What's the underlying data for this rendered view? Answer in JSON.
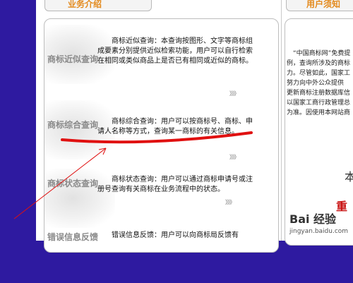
{
  "tabs": {
    "left_label": "业务介绍",
    "right_label": "用户须知"
  },
  "services": [
    {
      "name": "商标近似查询",
      "desc": "　　商标近似查询：本查询按图形、文字等商标组成要素分别提供近似检索功能，用户可以自行检索在相同或类似商品上是否已有相同或近似的商标。",
      "more": "》》》"
    },
    {
      "name": "商标综合查询",
      "desc": "　　商标综合查询：用户可以按商标号、商标、申请人名称等方式，查询某一商标的有关信息。",
      "more": "》》》"
    },
    {
      "name": "商标状态查询",
      "desc": "　　商标状态查询：用户可以通过商标申请号或注册号查询有关商标在业务流程中的状态。",
      "more": "》》》"
    },
    {
      "name": "错误信息反馈",
      "desc": "　　错误信息反馈：用户可以向商标局反馈有"
    }
  ],
  "notice_lines": [
    "　“中国商标网”免费提",
    "例，查询所涉及的商标",
    "力。尽管如此，国家工",
    "努力向中外公众提供",
    "更新商标注册数据库信",
    "以国家工商行政管理总",
    "为准。因使用本网站商"
  ],
  "right_partial_char": "本",
  "right_partial_char2": "重",
  "watermark": "Bai 经验",
  "watermark_url": "jingyan.baidu.com",
  "colors": {
    "background": "#2e1aa0",
    "annotation": "#e01010",
    "tab_text": "#e3891b"
  }
}
